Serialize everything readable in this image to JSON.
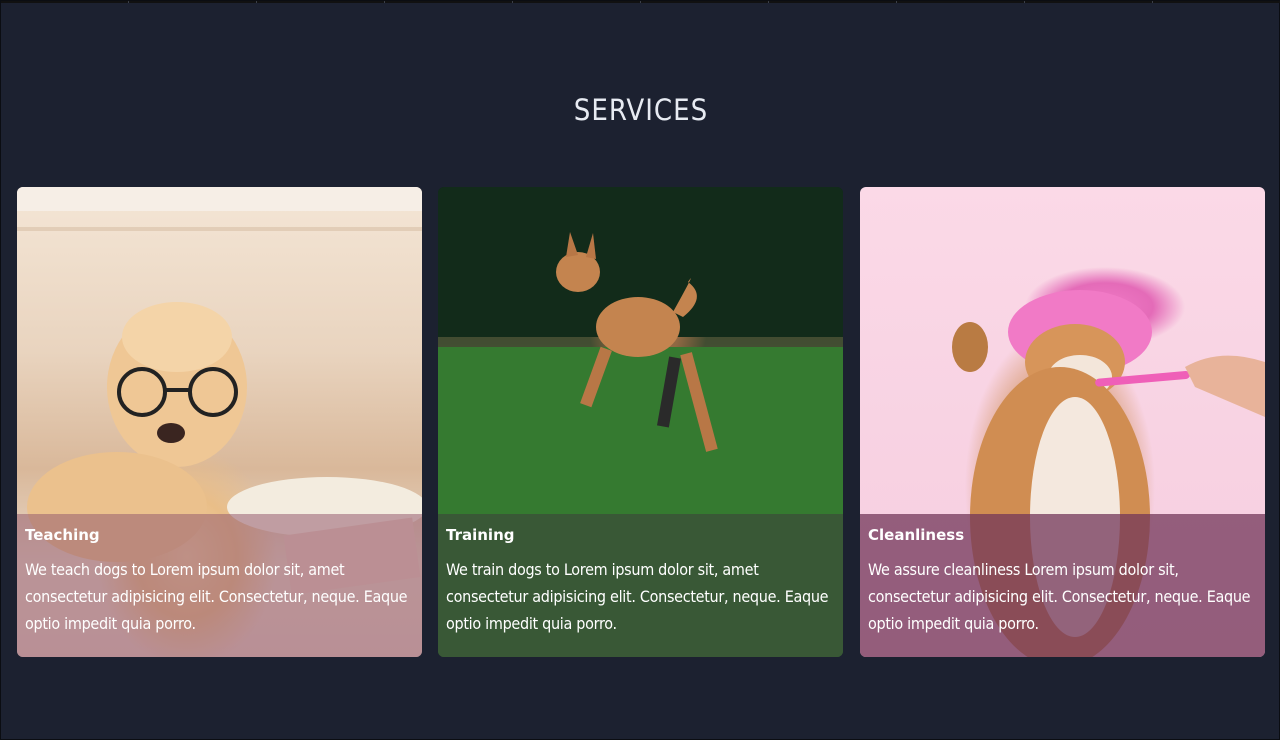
{
  "section": {
    "title": "SERVICES"
  },
  "cards": [
    {
      "title": "Teaching",
      "text": "We teach dogs to Lorem ipsum dolor sit, amet consectetur adipisicing elit. Consectetur, neque. Eaque optio impedit quia porro."
    },
    {
      "title": "Training",
      "text": "We train dogs to Lorem ipsum dolor sit, amet consectetur adipisicing elit. Consectetur, neque. Eaque optio impedit quia porro."
    },
    {
      "title": "Cleanliness",
      "text": "We assure cleanliness Lorem ipsum dolor sit, consectetur adipisicing elit. Consectetur, neque. Eaque optio impedit quia porro."
    }
  ],
  "colors": {
    "page_background": "#1c2130",
    "title_color": "#e7ebf2",
    "card_text": "#ffffff"
  }
}
